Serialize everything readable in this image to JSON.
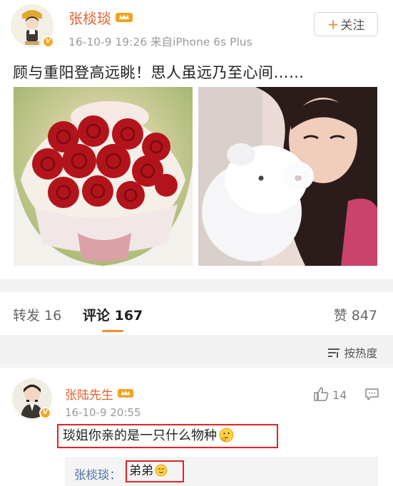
{
  "post": {
    "username": "张棪琰",
    "meta": "16-10-9 19:26  来自iPhone 6s Plus",
    "follow_label": "关注",
    "text": "顾与重阳登高远眺！思人虽远乃至心间……",
    "images": [
      "rose-bouquet-photo",
      "woman-kissing-teddy-bear-photo"
    ]
  },
  "tabs": {
    "repost": "转发 16",
    "comment": "评论 167",
    "like": "赞 847"
  },
  "sort": {
    "label": "按热度"
  },
  "comment": {
    "username": "张陆先生",
    "time": "16-10-9 20:55",
    "likes": "14",
    "text": "琰姐你亲的是一只什么物种",
    "reply": {
      "author": "张棪琰：",
      "text": "弟弟"
    }
  },
  "colors": {
    "username": "#e8602c",
    "accent": "#f08a2f",
    "highlight_box": "#e52222",
    "reply_author": "#4a6fa5"
  },
  "icons": [
    "vip-crown-icon",
    "verified-badge-icon",
    "sort-icon",
    "thumbs-up-icon",
    "reply-icon",
    "thinking-emoji",
    "smile-emoji"
  ]
}
